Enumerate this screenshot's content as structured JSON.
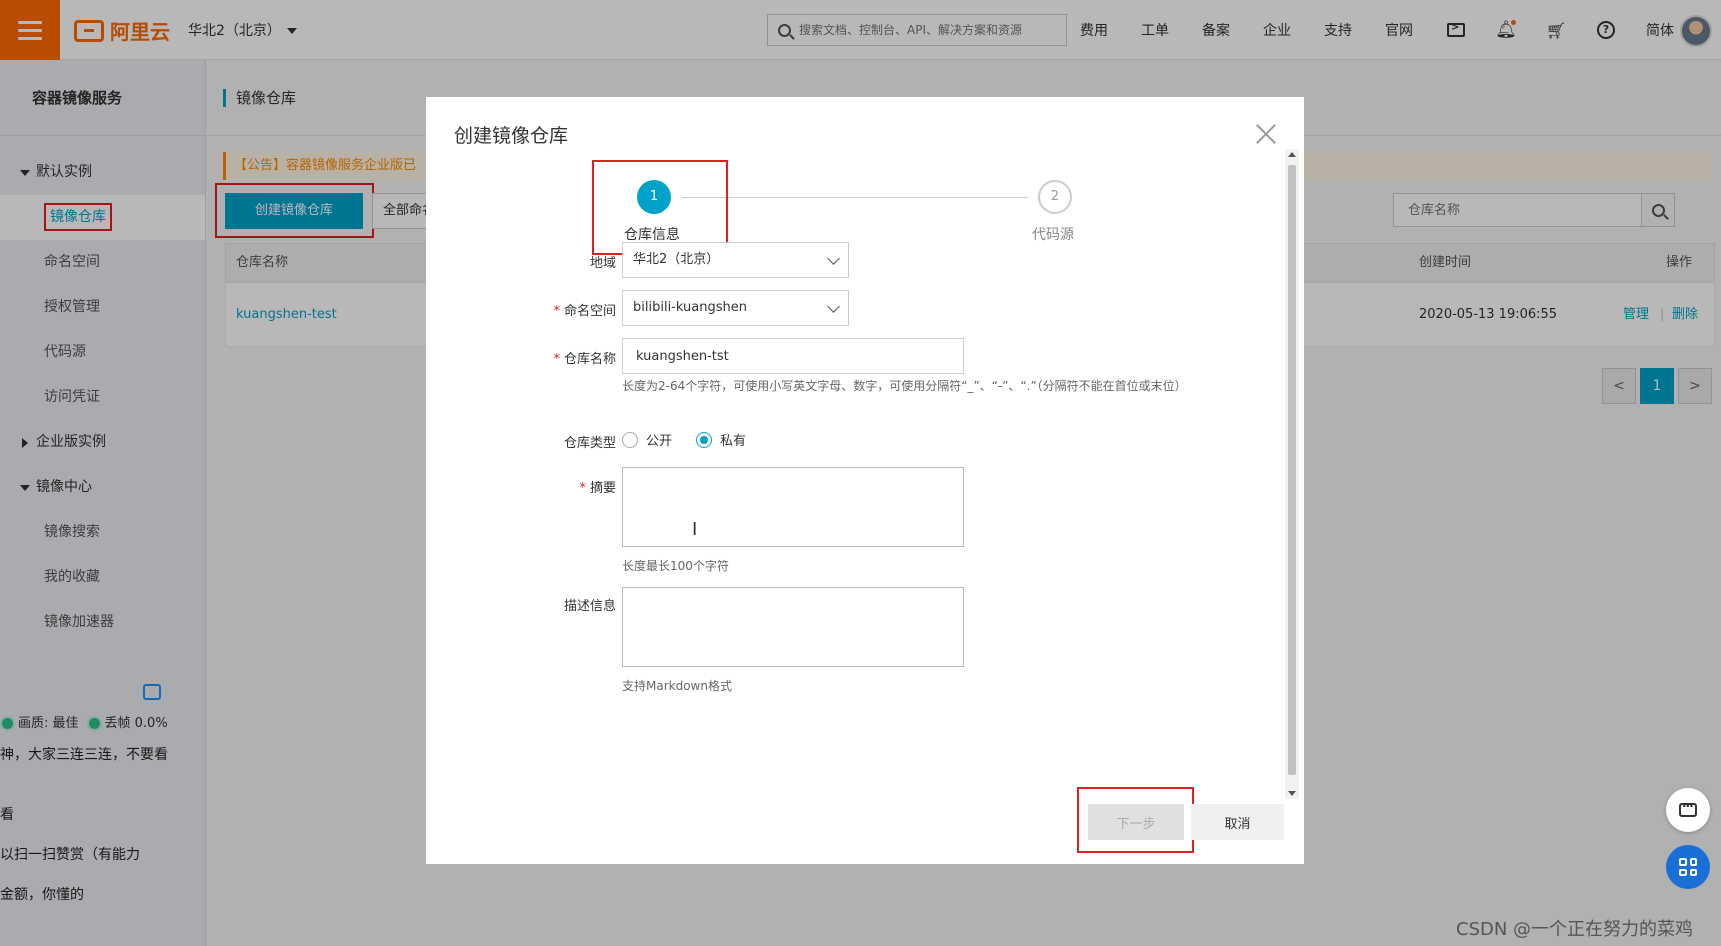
{
  "topbar": {
    "brand": "阿里云",
    "region": "华北2（北京）",
    "search_placeholder": "搜索文档、控制台、API、解决方案和资源",
    "nav": [
      "费用",
      "工单",
      "备案",
      "企业",
      "支持",
      "官网"
    ],
    "lang": "简体",
    "icons": [
      "terminal-icon",
      "bell-icon",
      "cart-icon",
      "help-icon"
    ]
  },
  "sidebar": {
    "title": "容器镜像服务",
    "group_default": "默认实例",
    "items_default": [
      "镜像仓库",
      "命名空间",
      "授权管理",
      "代码源",
      "访问凭证"
    ],
    "group_enterprise": "企业版实例",
    "group_mirror": "镜像中心",
    "items_mirror": [
      "镜像搜索",
      "我的收藏",
      "镜像加速器"
    ],
    "overlay_quality": "画质: 最佳",
    "overlay_dropped": "丢帧 0.0%",
    "overlay_lines": [
      "神，大家三连三连，不要看",
      "看",
      "以扫一扫赞赏（有能力",
      "金额，你懂的"
    ]
  },
  "main": {
    "header": "镜像仓库",
    "notice": "【公告】容器镜像服务企业版已",
    "create_button": "创建镜像仓库",
    "namespace_filter": "全部命名",
    "repo_search_placeholder": "仓库名称",
    "table": {
      "headers": [
        "仓库名称",
        "创建时间",
        "操作"
      ],
      "rows": [
        {
          "name": "kuangshen-test",
          "created": "2020-05-13 19:06:55",
          "manage": "管理",
          "delete": "删除"
        }
      ]
    },
    "pager": {
      "prev": "<",
      "current": "1",
      "next": ">"
    }
  },
  "modal": {
    "title": "创建镜像仓库",
    "steps": [
      {
        "num": "1",
        "label": "仓库信息"
      },
      {
        "num": "2",
        "label": "代码源"
      }
    ],
    "fields": {
      "region_label": "地域",
      "region_value": "华北2（北京）",
      "namespace_label": "命名空间",
      "namespace_value": "bilibili-kuangshen",
      "repo_name_label": "仓库名称",
      "repo_name_value": "kuangshen-tst",
      "repo_name_hint": "长度为2-64个字符，可使用小写英文字母、数字，可使用分隔符“_”、“-”、“.”（分隔符不能在首位或末位）",
      "repo_type_label": "仓库类型",
      "repo_type_public": "公开",
      "repo_type_private": "私有",
      "summary_label": "摘要",
      "summary_hint": "长度最长100个字符",
      "desc_label": "描述信息",
      "desc_hint": "支持Markdown格式"
    },
    "next_button": "下一步",
    "cancel_button": "取消"
  },
  "watermark": "CSDN @一个正在努力的菜鸡",
  "colors": {
    "brand": "#ff6a00",
    "accent": "#00a2ca",
    "highlight": "#e02020"
  }
}
